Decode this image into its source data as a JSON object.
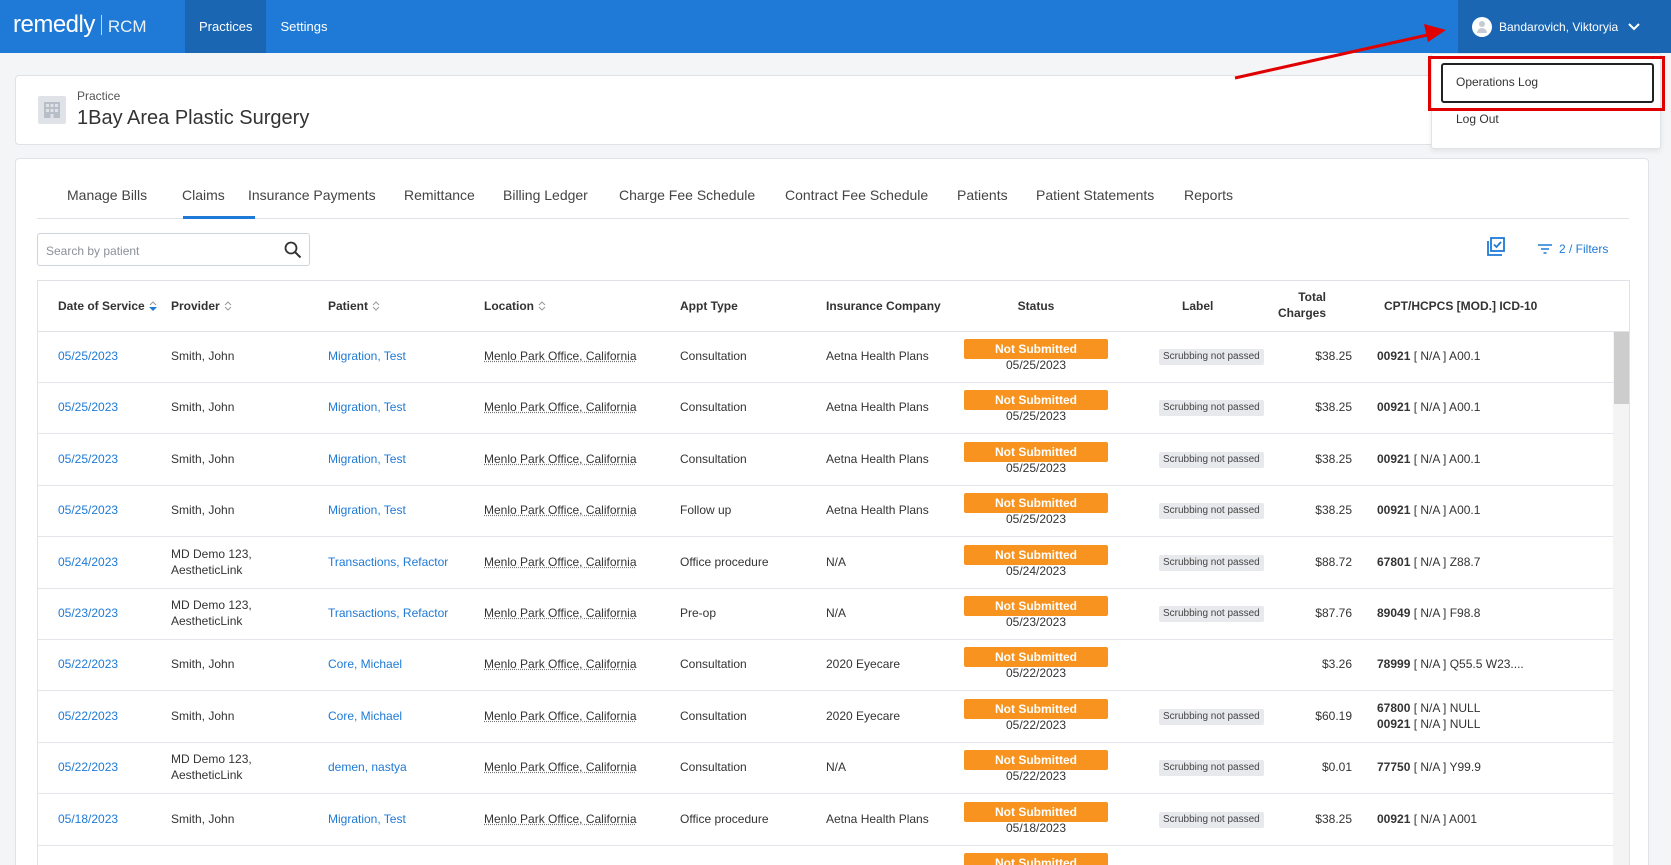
{
  "brand": {
    "name": "remedly",
    "product": "RCM"
  },
  "topnav": {
    "practices": "Practices",
    "settings": "Settings"
  },
  "user": {
    "name": "Bandarovich, Viktoryia"
  },
  "dropdown": {
    "operations_log": "Operations Log",
    "log_out": "Log Out"
  },
  "practice": {
    "label": "Practice",
    "name": "1Bay Area Plastic Surgery"
  },
  "tabs": [
    "Manage Bills",
    "Claims",
    "Insurance Payments",
    "Remittance",
    "Billing Ledger",
    "Charge Fee Schedule",
    "Contract Fee Schedule",
    "Patients",
    "Patient Statements",
    "Reports"
  ],
  "active_tab": "Claims",
  "search": {
    "placeholder": "Search by patient"
  },
  "filters": {
    "label": "2 / Filters"
  },
  "table": {
    "headers": {
      "date": "Date of Service",
      "provider": "Provider",
      "patient": "Patient",
      "location": "Location",
      "appt": "Appt Type",
      "insurance": "Insurance Company",
      "status": "Status",
      "label": "Label",
      "total1": "Total",
      "total2": "Charges",
      "cpt": "CPT/HCPCS [MOD.] ICD-10"
    },
    "rows": [
      {
        "date": "05/25/2023",
        "provider1": "Smith, John",
        "provider2": "",
        "patient": "Migration, Test",
        "location": "Menlo Park Office, California",
        "appt": "Consultation",
        "insurance": "Aetna Health Plans",
        "status": "Not Submitted",
        "status_date": "05/25/2023",
        "label": "Scrubbing not passed",
        "charges": "$38.25",
        "cpt1_code": "00921",
        "cpt1_rest": " [ N/A ] A00.1",
        "cpt2_code": "",
        "cpt2_rest": ""
      },
      {
        "date": "05/25/2023",
        "provider1": "Smith, John",
        "provider2": "",
        "patient": "Migration, Test",
        "location": "Menlo Park Office, California",
        "appt": "Consultation",
        "insurance": "Aetna Health Plans",
        "status": "Not Submitted",
        "status_date": "05/25/2023",
        "label": "Scrubbing not passed",
        "charges": "$38.25",
        "cpt1_code": "00921",
        "cpt1_rest": " [ N/A ] A00.1",
        "cpt2_code": "",
        "cpt2_rest": ""
      },
      {
        "date": "05/25/2023",
        "provider1": "Smith, John",
        "provider2": "",
        "patient": "Migration, Test",
        "location": "Menlo Park Office, California",
        "appt": "Consultation",
        "insurance": "Aetna Health Plans",
        "status": "Not Submitted",
        "status_date": "05/25/2023",
        "label": "Scrubbing not passed",
        "charges": "$38.25",
        "cpt1_code": "00921",
        "cpt1_rest": " [ N/A ] A00.1",
        "cpt2_code": "",
        "cpt2_rest": ""
      },
      {
        "date": "05/25/2023",
        "provider1": "Smith, John",
        "provider2": "",
        "patient": "Migration, Test",
        "location": "Menlo Park Office, California",
        "appt": "Follow up",
        "insurance": "Aetna Health Plans",
        "status": "Not Submitted",
        "status_date": "05/25/2023",
        "label": "Scrubbing not passed",
        "charges": "$38.25",
        "cpt1_code": "00921",
        "cpt1_rest": " [ N/A ] A00.1",
        "cpt2_code": "",
        "cpt2_rest": ""
      },
      {
        "date": "05/24/2023",
        "provider1": "MD Demo 123,",
        "provider2": "AestheticLink",
        "patient": "Transactions, Refactor",
        "location": "Menlo Park Office, California",
        "appt": "Office procedure",
        "insurance": "N/A",
        "status": "Not Submitted",
        "status_date": "05/24/2023",
        "label": "Scrubbing not passed",
        "charges": "$88.72",
        "cpt1_code": "67801",
        "cpt1_rest": " [ N/A ] Z88.7",
        "cpt2_code": "",
        "cpt2_rest": ""
      },
      {
        "date": "05/23/2023",
        "provider1": "MD Demo 123,",
        "provider2": "AestheticLink",
        "patient": "Transactions, Refactor",
        "location": "Menlo Park Office, California",
        "appt": "Pre-op",
        "insurance": "N/A",
        "status": "Not Submitted",
        "status_date": "05/23/2023",
        "label": "Scrubbing not passed",
        "charges": "$87.76",
        "cpt1_code": "89049",
        "cpt1_rest": " [ N/A ] F98.8",
        "cpt2_code": "",
        "cpt2_rest": ""
      },
      {
        "date": "05/22/2023",
        "provider1": "Smith, John",
        "provider2": "",
        "patient": "Core, Michael",
        "location": "Menlo Park Office, California",
        "appt": "Consultation",
        "insurance": "2020 Eyecare",
        "status": "Not Submitted",
        "status_date": "05/22/2023",
        "label": "",
        "charges": "$3.26",
        "cpt1_code": "78999",
        "cpt1_rest": " [ N/A ] Q55.5 W23....",
        "cpt2_code": "",
        "cpt2_rest": ""
      },
      {
        "date": "05/22/2023",
        "provider1": "Smith, John",
        "provider2": "",
        "patient": "Core, Michael",
        "location": "Menlo Park Office, California",
        "appt": "Consultation",
        "insurance": "2020 Eyecare",
        "status": "Not Submitted",
        "status_date": "05/22/2023",
        "label": "Scrubbing not passed",
        "charges": "$60.19",
        "cpt1_code": "67800",
        "cpt1_rest": " [ N/A ] NULL",
        "cpt2_code": "00921",
        "cpt2_rest": " [ N/A ] NULL"
      },
      {
        "date": "05/22/2023",
        "provider1": "MD Demo 123,",
        "provider2": "AestheticLink",
        "patient": "demen, nastya",
        "location": "Menlo Park Office, California",
        "appt": "Consultation",
        "insurance": "N/A",
        "status": "Not Submitted",
        "status_date": "05/22/2023",
        "label": "Scrubbing not passed",
        "charges": "$0.01",
        "cpt1_code": "77750",
        "cpt1_rest": " [ N/A ] Y99.9",
        "cpt2_code": "",
        "cpt2_rest": ""
      },
      {
        "date": "05/18/2023",
        "provider1": "Smith, John",
        "provider2": "",
        "patient": "Migration, Test",
        "location": "Menlo Park Office, California",
        "appt": "Office procedure",
        "insurance": "Aetna Health Plans",
        "status": "Not Submitted",
        "status_date": "05/18/2023",
        "label": "Scrubbing not passed",
        "charges": "$38.25",
        "cpt1_code": "00921",
        "cpt1_rest": " [ N/A ] A001",
        "cpt2_code": "",
        "cpt2_rest": ""
      },
      {
        "date": "",
        "provider1": "",
        "provider2": "",
        "patient": "",
        "location": "",
        "appt": "",
        "insurance": "",
        "status": "Not Submitted",
        "status_date": "",
        "label": "",
        "charges": "",
        "cpt1_code": "",
        "cpt1_rest": "",
        "cpt2_code": "",
        "cpt2_rest": ""
      }
    ]
  },
  "colors": {
    "header_blue": "#1e7ad6",
    "status_orange": "#f7931e",
    "link_blue": "#1e7ad6",
    "highlight_red": "#e10000"
  }
}
